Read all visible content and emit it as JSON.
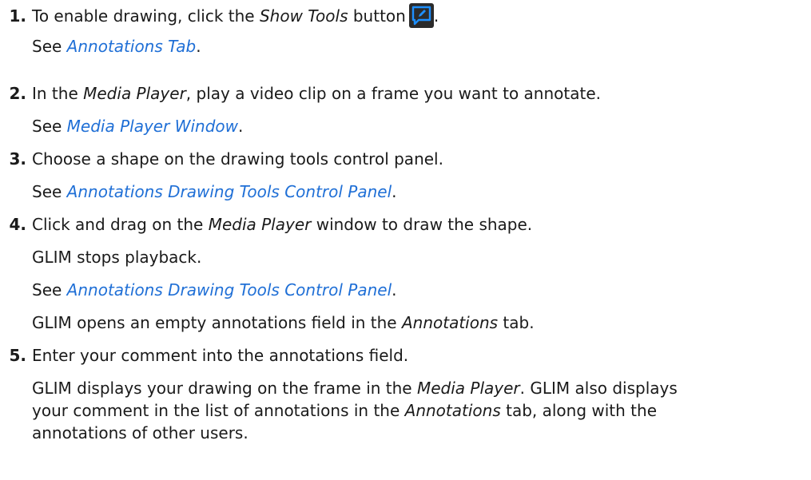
{
  "steps": [
    {
      "number": "1.",
      "text_before": "To enable drawing, click the ",
      "italic": "Show Tools",
      "text_after": " button",
      "end_punct": ".",
      "icon": "show-tools-icon",
      "see_prefix": "See ",
      "see_link": "Annotations Tab",
      "see_suffix": "."
    },
    {
      "number": "2.",
      "text_before": "In the ",
      "italic": "Media Player",
      "text_after": ", play a video clip on a frame you want to annotate.",
      "see_prefix": "See ",
      "see_link": "Media Player Window",
      "see_suffix": "."
    },
    {
      "number": "3.",
      "text": "Choose a shape on the drawing tools control panel.",
      "see_prefix": "See ",
      "see_link": "Annotations Drawing Tools Control Panel",
      "see_suffix": "."
    },
    {
      "number": "4.",
      "text_before": "Click and drag on the ",
      "italic": "Media Player",
      "text_after": " window to draw the shape.",
      "result1": "GLIM stops playback.",
      "see_prefix": "See ",
      "see_link": "Annotations Drawing Tools Control Panel",
      "see_suffix": ".",
      "result2_before": "GLIM opens an empty annotations field in the ",
      "result2_italic": "Annotations",
      "result2_after": " tab."
    },
    {
      "number": "5.",
      "text": "Enter your comment into the annotations field.",
      "result_line1_before": "GLIM displays your drawing on the frame in the ",
      "result_line1_italic": "Media Player",
      "result_line1_after": ". GLIM also displays",
      "result_line2_before": "your comment in the list of annotations in the ",
      "result_line2_italic": "Annotations",
      "result_line2_after": " tab, along with the",
      "result_line3": "annotations of other users."
    }
  ],
  "colors": {
    "link": "#1f6fd6",
    "icon_bg": "#2b2b2b",
    "icon_accent": "#1e90ff"
  }
}
